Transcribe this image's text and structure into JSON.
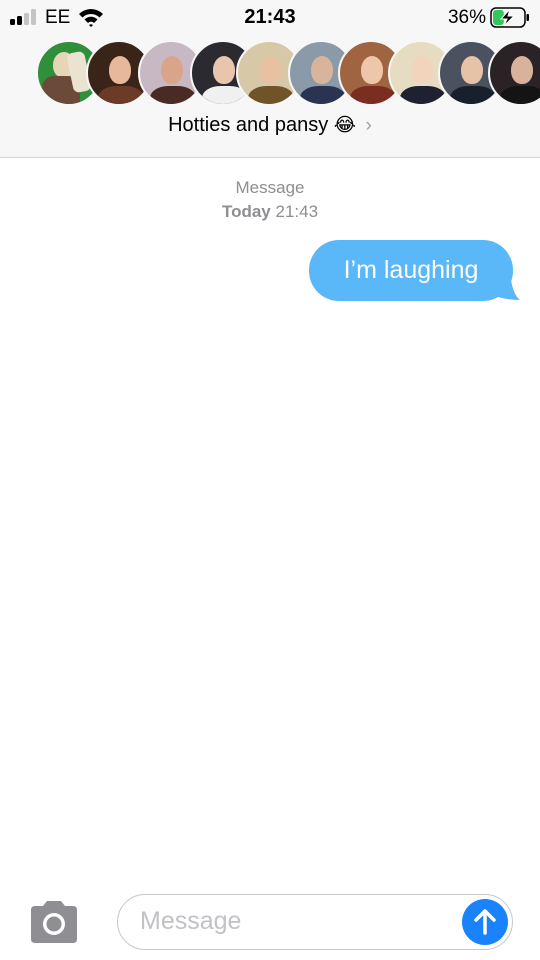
{
  "status_bar": {
    "carrier": "EE",
    "time": "21:43",
    "battery_percent": "36%",
    "battery_level": 0.36,
    "signal_bars_active": 2,
    "signal_bars_total": 4
  },
  "header": {
    "group_name": "Hotties and pansy",
    "group_emoji": "😂",
    "chevron": "›",
    "avatar_count": 10
  },
  "conversation": {
    "service_label": "Message",
    "day_label": "Today",
    "time_label": "21:43",
    "messages": [
      {
        "direction": "outgoing",
        "text": "I’m laughing"
      }
    ]
  },
  "composer": {
    "placeholder": "Message",
    "camera_icon": "camera-icon",
    "send_icon": "arrow-up-icon"
  },
  "colors": {
    "outgoing_bubble": "#5ab8f8",
    "send_button": "#1a82fb",
    "header_bg": "#f7f7f7",
    "meta_text": "#8e8e93",
    "battery_charging": "#34c759"
  }
}
